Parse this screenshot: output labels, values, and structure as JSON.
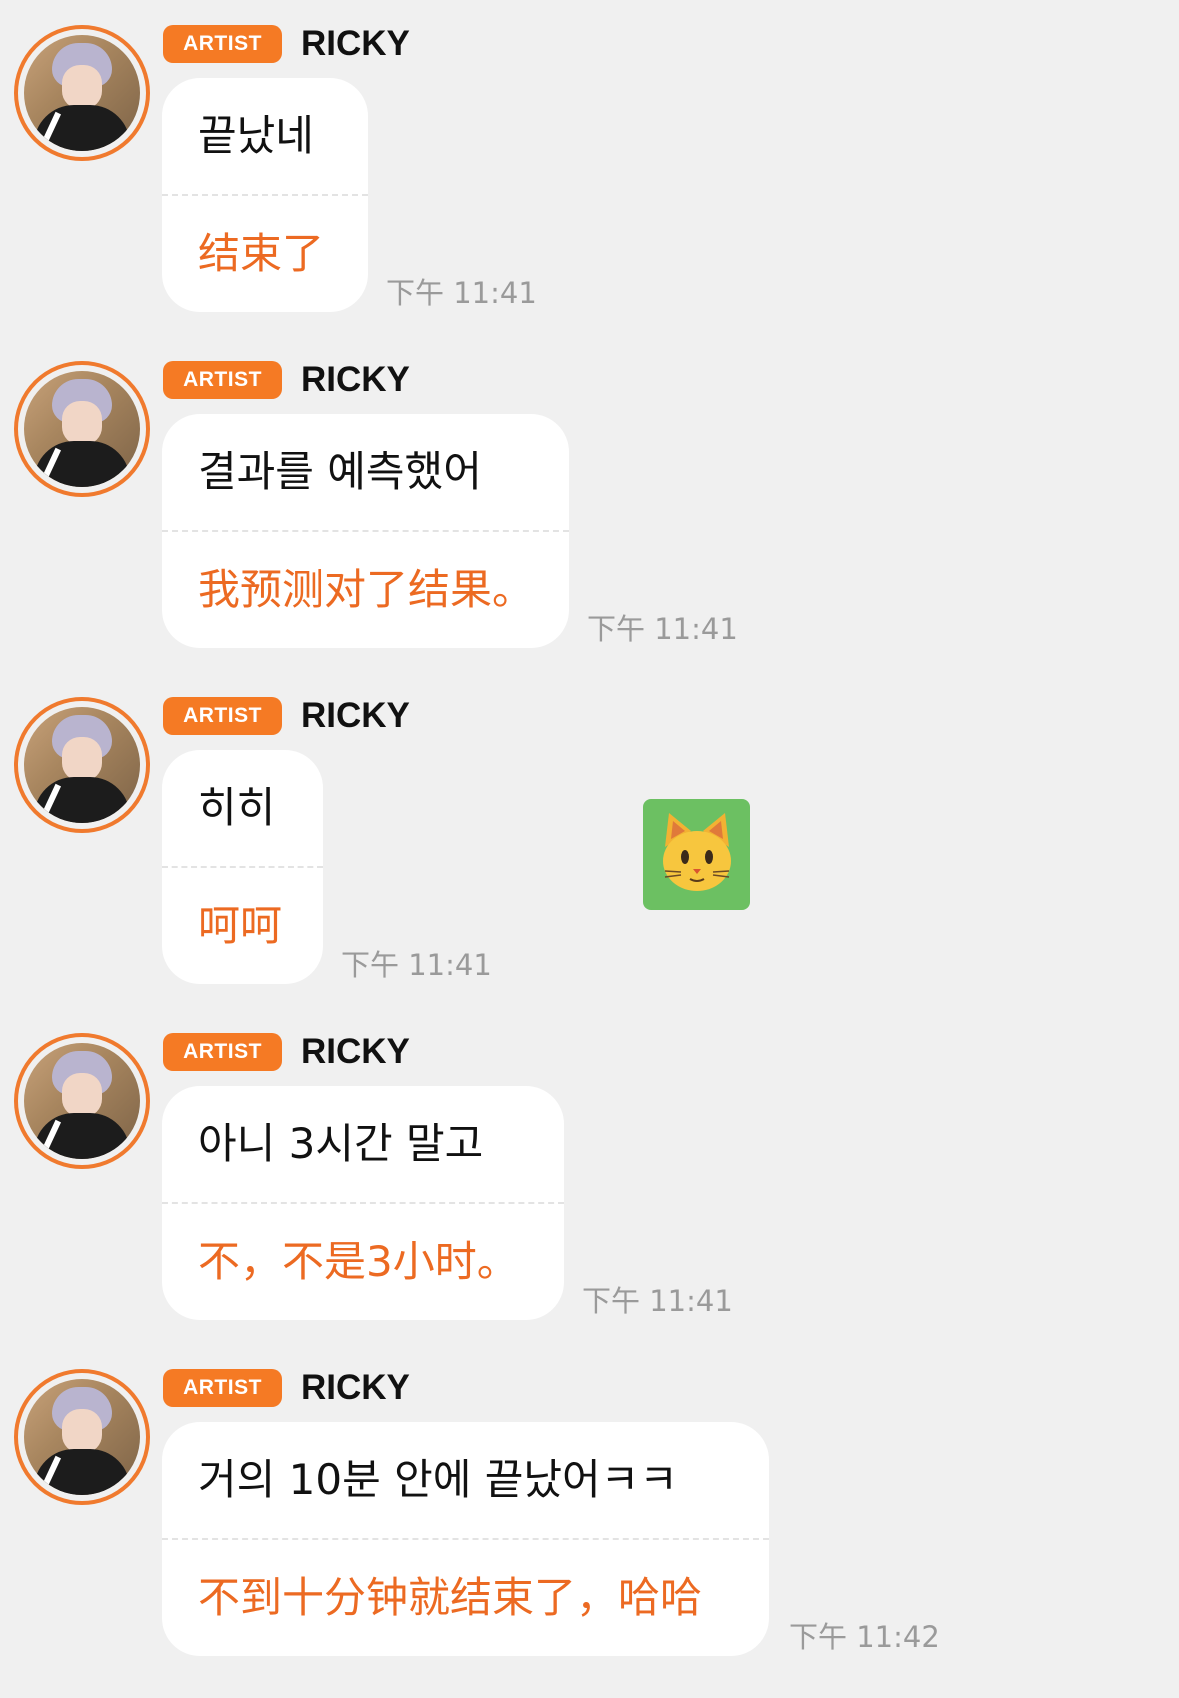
{
  "messages": [
    {
      "badge": "ARTIST",
      "sender": "RICKY",
      "korean": "끝났네",
      "chinese": "结束了",
      "time": "下午 11:41"
    },
    {
      "badge": "ARTIST",
      "sender": "RICKY",
      "korean": "결과를 예측했어",
      "chinese": "我预测对了结果。",
      "time": "下午 11:41"
    },
    {
      "badge": "ARTIST",
      "sender": "RICKY",
      "korean": "히히",
      "chinese": "呵呵",
      "time": "下午 11:41"
    },
    {
      "badge": "ARTIST",
      "sender": "RICKY",
      "korean": "아니 3시간 말고",
      "chinese": "不，不是3小时。",
      "time": "下午 11:41"
    },
    {
      "badge": "ARTIST",
      "sender": "RICKY",
      "korean": "거의 10분 안에 끝났어ㅋㅋ",
      "chinese": "不到十分钟就结束了，哈哈",
      "time": "下午 11:42"
    }
  ],
  "sticker": {
    "icon": "cat-face-icon",
    "background": "#6cc062"
  },
  "colors": {
    "accent": "#f57a24",
    "translation": "#ec6a22",
    "avatar_ring": "#f07a2e",
    "background": "#f0f0f0",
    "bubble": "#ffffff",
    "timestamp": "#9a9a9a"
  }
}
